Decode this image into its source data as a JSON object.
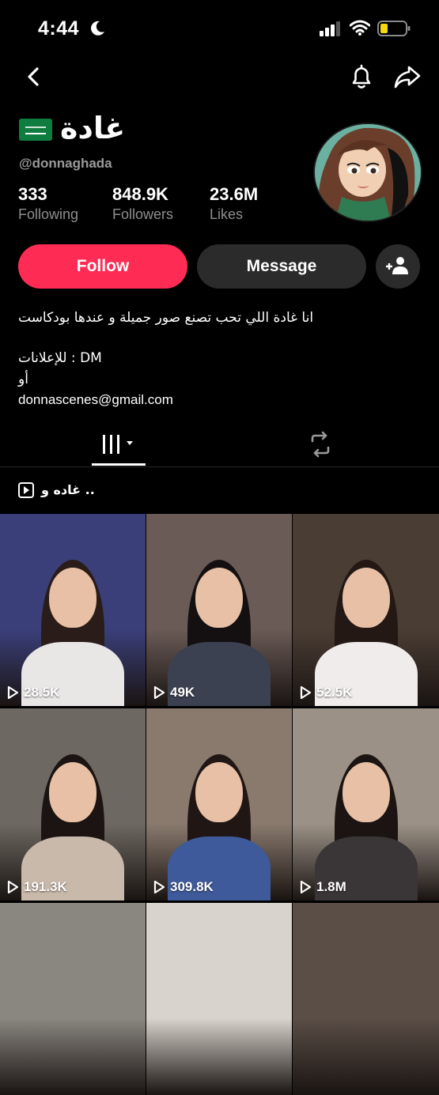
{
  "status_bar": {
    "time": "4:44"
  },
  "profile": {
    "display_name": "غادة",
    "username": "@donnaghada",
    "stats": [
      {
        "value": "333",
        "label": "Following"
      },
      {
        "value": "848.9K",
        "label": "Followers"
      },
      {
        "value": "23.6M",
        "label": "Likes"
      }
    ],
    "follow_label": "Follow",
    "message_label": "Message",
    "bio": [
      "انا غادة اللي تحب تصنع صور جميلة و عندها بودكاست",
      "",
      "للإعلانات : DM",
      "أو",
      "donnascenes@gmail.com"
    ]
  },
  "playlist": {
    "label": "غاده و .."
  },
  "videos": [
    {
      "views": "28.5K",
      "bg": "#3a3f7a",
      "shirt": "#e9e6e6",
      "hair": "#2a1c18"
    },
    {
      "views": "49K",
      "bg": "#6a5b56",
      "shirt": "#3b4150",
      "hair": "#141012"
    },
    {
      "views": "52.5K",
      "bg": "#4a3d34",
      "shirt": "#efeceb",
      "hair": "#231814"
    },
    {
      "views": "191.3K",
      "bg": "#6e6862",
      "shirt": "#c9b9ab",
      "hair": "#1b1412"
    },
    {
      "views": "309.8K",
      "bg": "#8a7a6e",
      "shirt": "#3e5a9a",
      "hair": "#201614"
    },
    {
      "views": "1.8M",
      "bg": "#9b9186",
      "shirt": "#3a3536",
      "hair": "#1c1412"
    },
    {
      "views": "",
      "bg": "#8a8680",
      "shirt": "#8a8680",
      "hair": "#2a2020"
    },
    {
      "views": "",
      "bg": "#d8d3cc",
      "shirt": "#d8d3cc",
      "hair": "#d8d3cc"
    },
    {
      "views": "",
      "bg": "#5a4e46",
      "shirt": "#5a4e46",
      "hair": "#2a1e18"
    }
  ],
  "colors": {
    "accent": "#fe2c55",
    "secondary_button": "#2b2b2b",
    "muted_text": "#8e8e8e"
  }
}
